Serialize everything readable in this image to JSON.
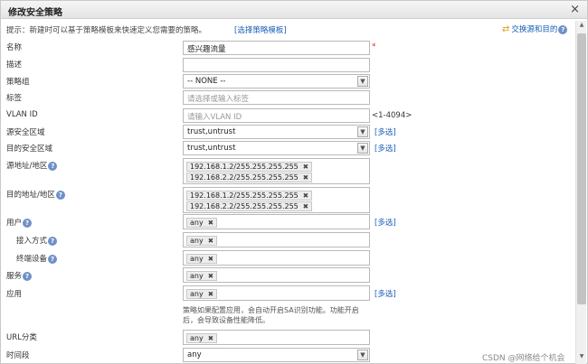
{
  "dialog": {
    "title": "修改安全策略",
    "close": "×"
  },
  "tip": {
    "text": "提示：新建时可以基于策略模板来快速定义您需要的策略。",
    "link": "[选择策略模板]",
    "swap_link": "交换源和目的"
  },
  "form": {
    "name": {
      "label": "名称",
      "value": "感兴趣流量",
      "required": "*"
    },
    "description": {
      "label": "描述",
      "value": ""
    },
    "policy_group": {
      "label": "策略组",
      "value": "-- NONE --"
    },
    "tag": {
      "label": "标签",
      "placeholder": "请选择或输入标签"
    },
    "vlan": {
      "label": "VLAN ID",
      "placeholder": "请输入VLAN ID",
      "range": "<1-4094>"
    },
    "src_zone": {
      "label": "源安全区域",
      "value": "trust,untrust",
      "multi": "[多选]"
    },
    "dst_zone": {
      "label": "目的安全区域",
      "value": "trust,untrust",
      "multi": "[多选]"
    },
    "src_addr": {
      "label": "源地址/地区",
      "tags": [
        "192.168.1.2/255.255.255.255",
        "192.168.2.2/255.255.255.255"
      ]
    },
    "dst_addr": {
      "label": "目的地址/地区",
      "tags": [
        "192.168.1.2/255.255.255.255",
        "192.168.2.2/255.255.255.255"
      ]
    },
    "user": {
      "label": "用户",
      "tag": "any",
      "multi": "[多选]"
    },
    "access_mode": {
      "label": "接入方式",
      "tag": "any"
    },
    "terminal": {
      "label": "终端设备",
      "tag": "any"
    },
    "service": {
      "label": "服务",
      "tag": "any"
    },
    "application": {
      "label": "应用",
      "tag": "any",
      "multi": "[多选]",
      "note": "策略如果配置应用，会自动开启SA识别功能。功能开启后，会导致设备性能降低。"
    },
    "url_category": {
      "label": "URL分类",
      "tag": "any"
    },
    "time_range": {
      "label": "时间段",
      "value": "any"
    }
  },
  "help_glyph": "?",
  "tag_remove_glyph": "✖",
  "watermark": "CSDN @网络给个机会"
}
